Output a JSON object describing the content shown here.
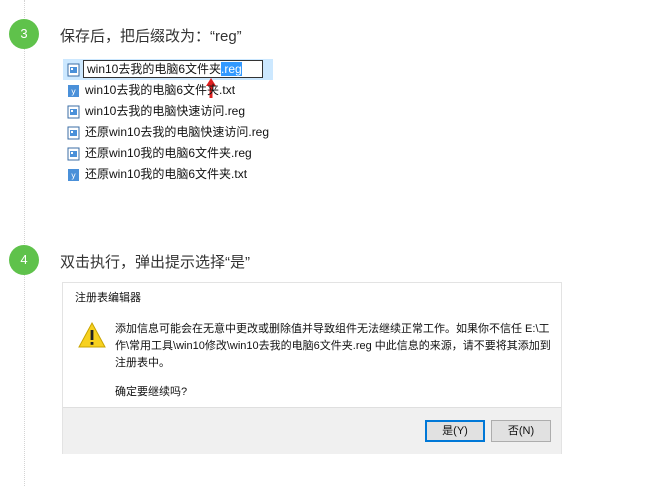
{
  "steps": [
    {
      "number": "3",
      "title": "保存后，把后缀改为：“reg”"
    },
    {
      "number": "4",
      "title": "双击执行，弹出提示选择“是”"
    }
  ],
  "file_list": {
    "rename_base": "win10去我的电脑6文件夹",
    "rename_ext": ".reg",
    "files": [
      "win10去我的电脑6文件夹.txt",
      "win10去我的电脑快速访问.reg",
      "还原win10去我的电脑快速访问.reg",
      "还原win10我的电脑6文件夹.reg",
      "还原win10我的电脑6文件夹.txt"
    ]
  },
  "dialog": {
    "title": "注册表编辑器",
    "message": "添加信息可能会在无意中更改或删除值并导致组件无法继续正常工作。如果你不信任 E:\\工作\\常用工具\\win10修改\\win10去我的电脑6文件夹.reg 中此信息的来源，请不要将其添加到注册表中。",
    "question": "确定要继续吗?",
    "yes_label": "是(Y)",
    "no_label": "否(N)"
  },
  "colors": {
    "badge": "#5fc24b",
    "selection": "#3399ff",
    "arrow": "#e02020"
  }
}
